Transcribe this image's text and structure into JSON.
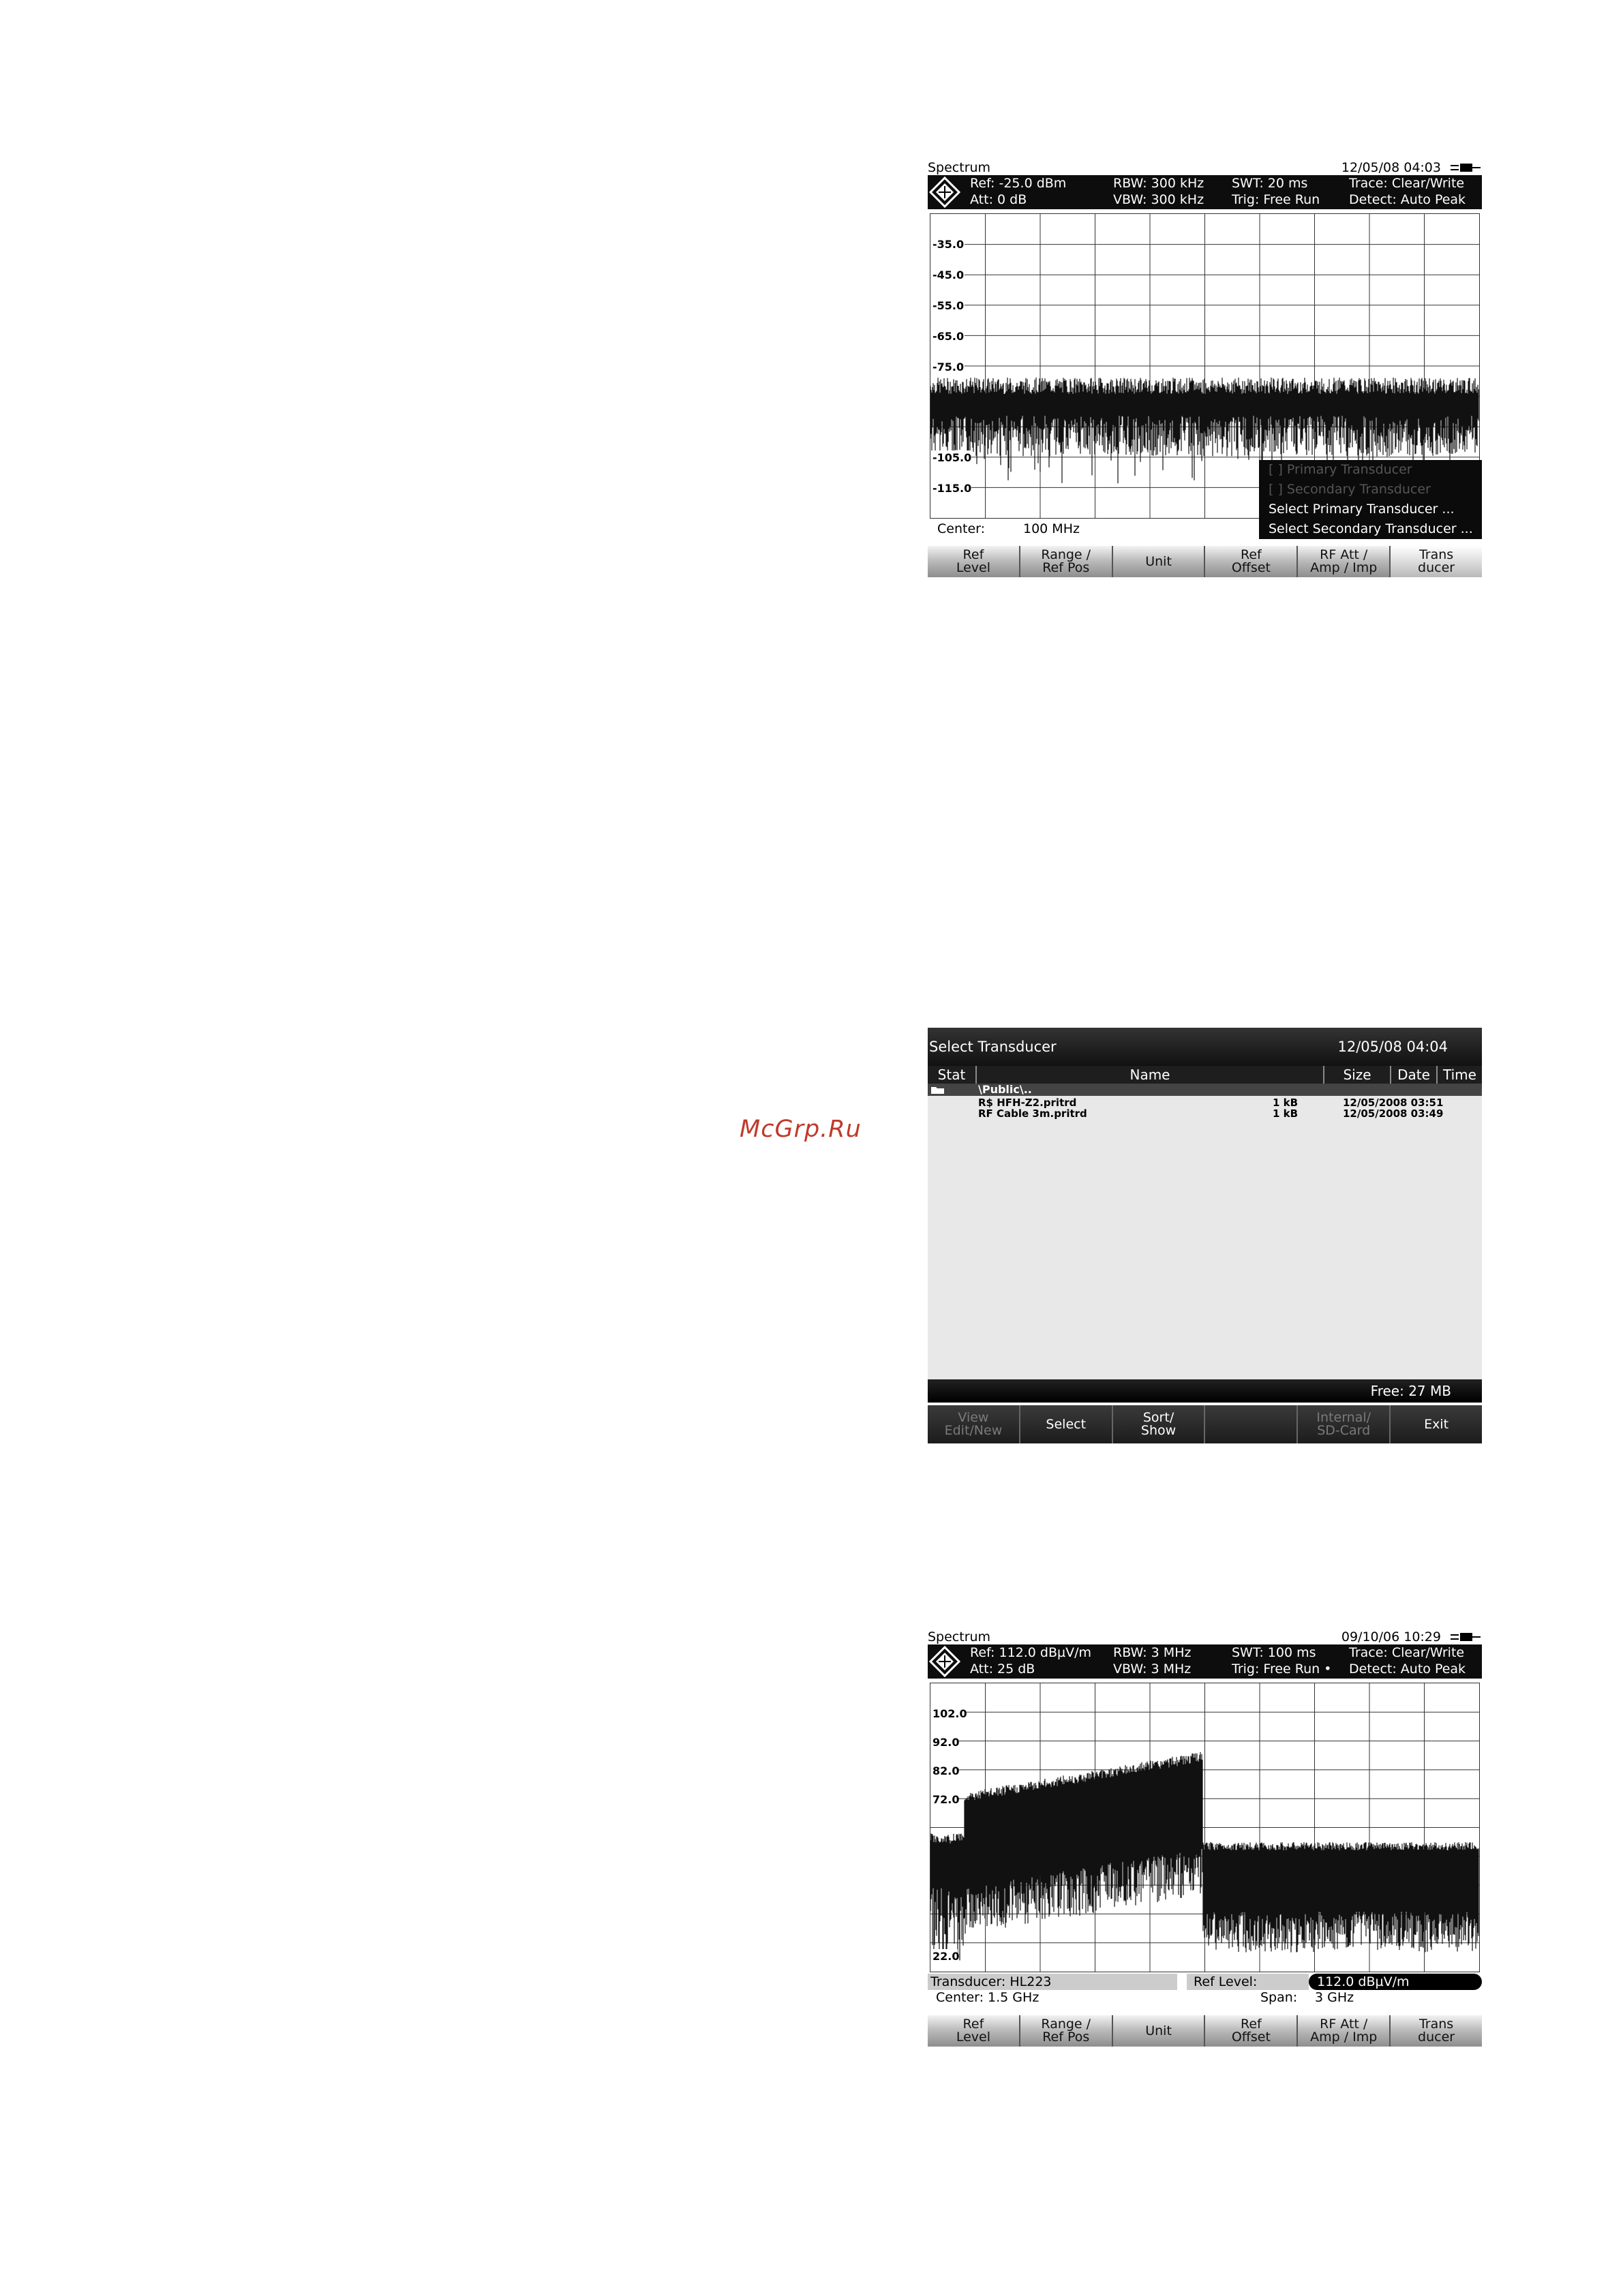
{
  "watermark": "McGrp.Ru",
  "screen1": {
    "mode": "Spectrum",
    "datetime": "12/05/08   04:03",
    "ref": "Ref:  -25.0 dBm",
    "att": "Att:  0 dB",
    "rbw": "RBW:  300 kHz",
    "vbw": "VBW:  300 kHz",
    "swt": "SWT:   20 ms",
    "trig": "Trig:   Free Run",
    "trace": "Trace:  Clear/Write",
    "detect": "Detect: Auto Peak",
    "y_labels": [
      "-35.0",
      "-45.0",
      "-55.0",
      "-65.0",
      "-75.0",
      "-105.0",
      "-115.0"
    ],
    "center_label": "Center:",
    "center_value": "100 MHz",
    "menu": {
      "primary": "[ ] Primary Transducer",
      "secondary": "[ ] Secondary Transducer",
      "select_primary": "Select Primary Transducer ...",
      "select_secondary": "Select Secondary Transducer ..."
    },
    "softkeys": [
      "Ref\nLevel",
      "Range /\nRef Pos",
      "Unit",
      "Ref\nOffset",
      "RF Att /\nAmp / Imp",
      "Trans\nducer"
    ]
  },
  "screen2": {
    "title": "Select Transducer",
    "datetime": "12/05/08 04:04",
    "columns": [
      "Stat",
      "Name",
      "Size",
      "Date",
      "Time"
    ],
    "folder": "\\Public\\..",
    "files": [
      {
        "name": "R$ HFH-Z2.pritrd",
        "size": "1 kB",
        "date": "12/05/2008 03:51"
      },
      {
        "name": "RF Cable 3m.pritrd",
        "size": "1 kB",
        "date": "12/05/2008 03:49"
      }
    ],
    "free": "Free: 27 MB",
    "softkeys": [
      "View\nEdit/New",
      "Select",
      "Sort/\nShow",
      "",
      "Internal/\nSD-Card",
      "Exit"
    ]
  },
  "screen3": {
    "mode": "Spectrum",
    "datetime": "09/10/06   10:29",
    "ref": "Ref:  112.0 dBµV/m",
    "att": "Att:  25 dB",
    "rbw": "RBW:  3 MHz",
    "vbw": "VBW:  3 MHz",
    "swt": "SWT:   100 ms",
    "trig": "Trig:   Free Run  •",
    "trace": "Trace:  Clear/Write",
    "detect": "Detect: Auto Peak",
    "y_labels": [
      "102.0",
      "92.0",
      "82.0",
      "72.0",
      "22.0"
    ],
    "transducer": "Transducer:  HL223",
    "ref_level_label": "Ref Level:",
    "ref_level_value": "112.0 dBµV/m",
    "center": "Center:  1.5 GHz",
    "span_label": "Span:",
    "span_value": "3 GHz",
    "softkeys": [
      "Ref\nLevel",
      "Range /\nRef Pos",
      "Unit",
      "Ref\nOffset",
      "RF Att /\nAmp / Imp",
      "Trans\nducer"
    ]
  }
}
